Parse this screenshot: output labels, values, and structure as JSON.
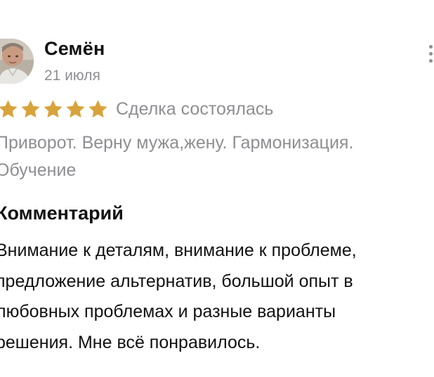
{
  "review": {
    "author": {
      "name": "Семён",
      "avatar_icon": "user-photo-avatar"
    },
    "date": "21 июля",
    "more_icon": "more-vertical-icon",
    "rating": {
      "stars": 5,
      "max": 5,
      "star_color": "#d8a33b"
    },
    "deal_status": "Сделка состоялась",
    "service": {
      "lines": [
        "Приворот. Верну мужа,жену. Гармонизация.",
        "Обучение"
      ]
    },
    "comment": {
      "heading": "Комментарий",
      "lines": [
        "Внимание к деталям, внимание к проблеме,",
        "предложение альтернатив, большой опыт в",
        "любовных проблемах и разные варианты",
        "решения. Мне всё понравилось."
      ]
    }
  }
}
